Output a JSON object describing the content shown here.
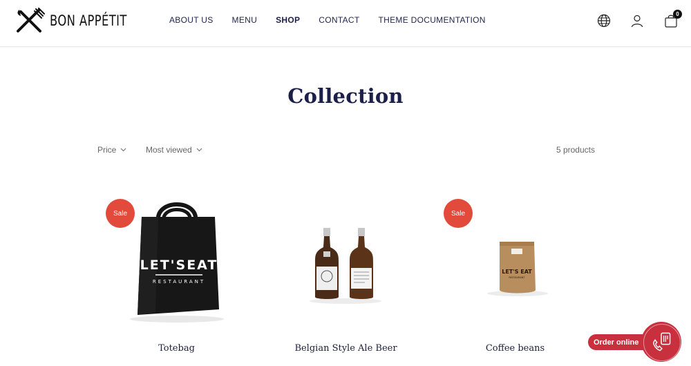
{
  "brand": {
    "name": "BON APPÉTIT"
  },
  "nav": {
    "items": [
      {
        "label": "ABOUT US"
      },
      {
        "label": "MENU"
      },
      {
        "label": "SHOP",
        "active": true
      },
      {
        "label": "CONTACT"
      },
      {
        "label": "THEME DOCUMENTATION"
      }
    ]
  },
  "header_icons": [
    "globe-icon",
    "user-icon",
    "cart-icon"
  ],
  "cart": {
    "count": "0"
  },
  "page": {
    "title": "Collection"
  },
  "filters": {
    "price_label": "Price",
    "sort_label": "Most viewed",
    "product_count": "5 products"
  },
  "products": [
    {
      "name": "Totebag",
      "sale": "Sale"
    },
    {
      "name": "Belgian Style Ale Beer"
    },
    {
      "name": "Coffee beans",
      "sale": "Sale"
    }
  ],
  "order": {
    "label": "Order online"
  },
  "colors": {
    "accent": "#e24a3b",
    "order_red": "#c8303e",
    "navy": "#1b1f4a"
  }
}
